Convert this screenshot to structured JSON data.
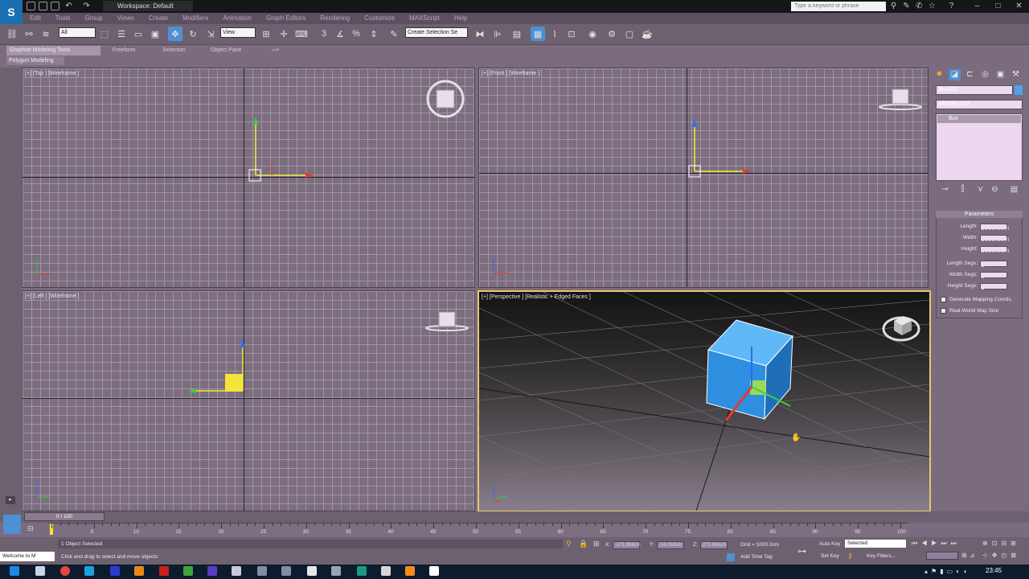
{
  "titlebar": {
    "workspace_label": "Workspace: Default",
    "search_placeholder": "Type a keyword or phrase"
  },
  "menu": [
    "Edit",
    "Tools",
    "Group",
    "Views",
    "Create",
    "Modifiers",
    "Animation",
    "Graph Editors",
    "Rendering",
    "Customize",
    "MAXScript",
    "Help"
  ],
  "toolbar": {
    "selection_filter": "All",
    "reference_coord": "View",
    "named_selection": "Create Selection Se"
  },
  "ribbon": {
    "tabs": [
      "Graphite Modeling Tools",
      "Freeform",
      "Selection",
      "Object Paint"
    ],
    "panel_label": "Polygon Modeling"
  },
  "viewports": {
    "top_label": "[+] [Top ] [Wireframe ]",
    "front_label": "[+] [Front ] [Wireframe ]",
    "left_label": "[+] [Left ] [Wireframe ]",
    "persp_label": "[+] [Perspective ] [Realistic + Edged Faces ]"
  },
  "command_panel": {
    "object_name": "Box001",
    "modifier_list": "Modifier List",
    "stack_item": "Box",
    "rollout_title": "Parameters",
    "params": [
      {
        "label": "Length:",
        "value": "1000.0cm"
      },
      {
        "label": "Width:",
        "value": "1000.0cm"
      },
      {
        "label": "Height:",
        "value": "1000.0cm"
      },
      {
        "label": "Length Segs:",
        "value": "1"
      },
      {
        "label": "Width Segs:",
        "value": "1"
      },
      {
        "label": "Height Segs:",
        "value": "1"
      }
    ],
    "checkboxes": [
      "Generate Mapping Coords.",
      "Real-World Map Size"
    ]
  },
  "timeline": {
    "slider": "0 / 100",
    "ticks": [
      "5",
      "10",
      "15",
      "20",
      "25",
      "30",
      "35",
      "40",
      "45",
      "50",
      "55",
      "60",
      "65",
      "70",
      "75",
      "80",
      "85",
      "90",
      "95",
      "100"
    ]
  },
  "status": {
    "selected_count": "1 Object Selected",
    "prompt": "Click and drag to select and move objects",
    "x_label": "X:",
    "y_label": "Y:",
    "z_label": "Z:",
    "x_value": "-271.984cm",
    "y_value": "-94.818cm",
    "z_value": "271.984cm",
    "grid": "Grid = 1000.0cm",
    "auto_key": "Auto Key",
    "set_key": "Set Key",
    "key_mode": "Selected",
    "key_filters": "Key Filters...",
    "add_time_tag": "Add Time Tag",
    "listener": "Welcome to M"
  },
  "taskbar": {
    "clock": "23:45"
  },
  "colors": {
    "ui_background": "#7a6b7e",
    "active_tool": "#4f8fd3",
    "box_object": "#3b9be6",
    "active_viewport_border": "#e8c86a"
  }
}
